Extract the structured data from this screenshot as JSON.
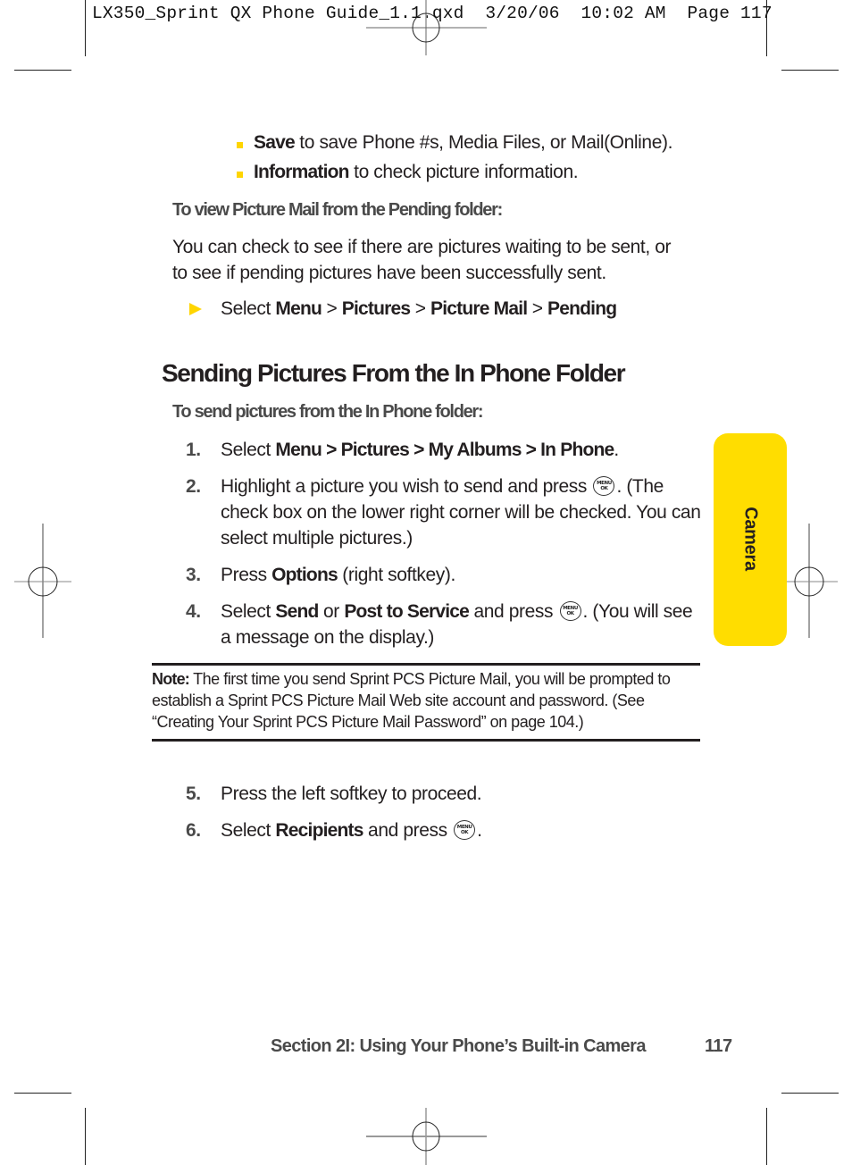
{
  "slug": {
    "text": "LX350_Sprint QX Phone Guide_1.1.qxd  3/20/06  10:02 AM  Page 117"
  },
  "options_list": [
    {
      "bold": "Save",
      "rest": " to save Phone #s, Media Files, or Mail(Online)."
    },
    {
      "bold": "Information",
      "rest": " to check picture information."
    }
  ],
  "pending": {
    "subhead": "To view Picture Mail from the Pending folder:",
    "paragraph_line1": "You can check to see if there are pictures waiting to be sent, or",
    "paragraph_line2": "to see if pending pictures have been successfully sent.",
    "path_prefix": "Select ",
    "path": [
      "Menu",
      "Pictures",
      "Picture Mail",
      "Pending"
    ],
    "sep": " > "
  },
  "section": {
    "heading": "Sending Pictures From the In Phone Folder",
    "subhead": "To send pictures from the In Phone folder:",
    "steps": [
      {
        "num": "1.",
        "pre": "Select ",
        "bold": "Menu > Pictures > My Albums > In Phone",
        "post": "."
      },
      {
        "num": "2.",
        "pre": "Highlight a picture you wish to send and press ",
        "post": ". (The check box on the lower right corner will be checked. You can select multiple pictures.)"
      },
      {
        "num": "3.",
        "pre": "Press ",
        "bold": "Options",
        "post": " (right softkey)."
      },
      {
        "num": "4.",
        "pre": "Select ",
        "bold": "Send",
        "mid": " or ",
        "bold2": "Post to Service",
        "mid2": " and press ",
        "post": ". (You will see a message on the display.)"
      },
      {
        "num": "5.",
        "pre": "Press the left softkey to proceed."
      },
      {
        "num": "6.",
        "pre": "Select ",
        "bold": "Recipients",
        "mid": " and press ",
        "post": "."
      }
    ]
  },
  "note": {
    "label": "Note:",
    "text": " The first time you send Sprint PCS Picture Mail, you will be prompted to establish a Sprint PCS Picture Mail Web site account and password. (See “Creating Your Sprint PCS Picture Mail Password” on page 104.)"
  },
  "menu_key": {
    "line1": "MENU",
    "line2": "OK"
  },
  "side_tab": {
    "label": "Camera",
    "color": "#ffdd00"
  },
  "footer": {
    "section": "Section 2I: Using Your Phone’s Built-in Camera",
    "page": "117"
  },
  "colors": {
    "accent": "#ffd500",
    "text": "#231f20",
    "subhead": "#4a4a4a"
  }
}
